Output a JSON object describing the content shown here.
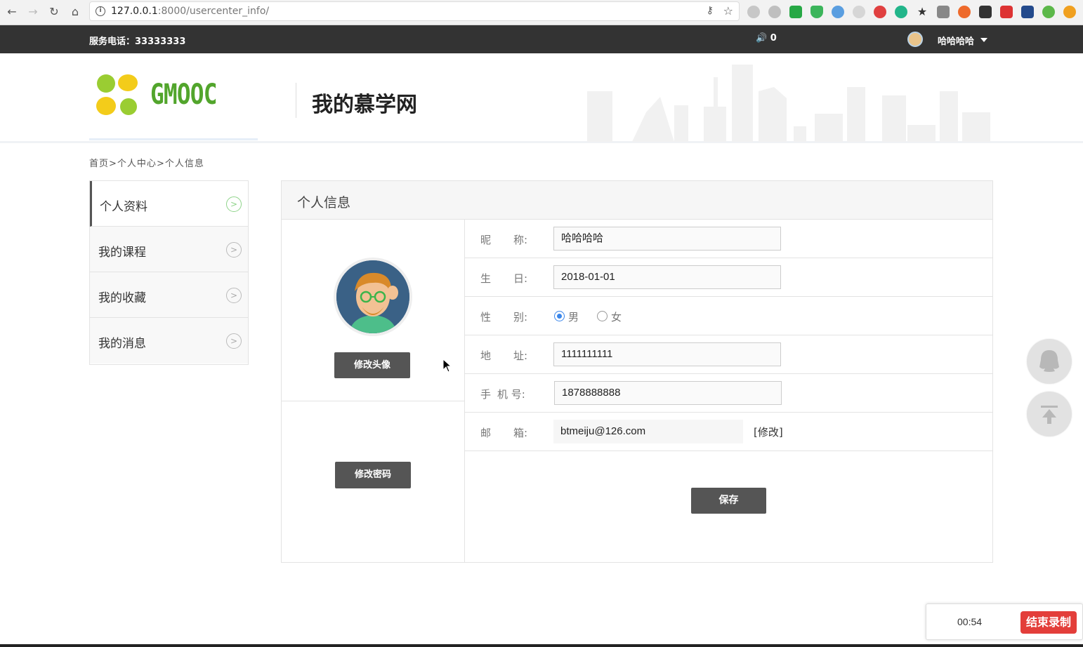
{
  "browser": {
    "url_host": "127.0.0.1",
    "url_rest": ":8000/usercenter_info/"
  },
  "topbar": {
    "phone": "服务电话：33333333",
    "sound_count": "0",
    "username": "哈哈哈哈"
  },
  "header": {
    "logo_text": "GMOOC",
    "title": "我的慕学网",
    "brand_color": "#52a52c"
  },
  "breadcrumb": {
    "home": "首页",
    "sep1": ">",
    "center": "个人中心",
    "sep2": ">",
    "current": "个人信息"
  },
  "sidebar": {
    "items": [
      {
        "label": "个人资料",
        "active": true
      },
      {
        "label": "我的课程",
        "active": false
      },
      {
        "label": "我的收藏",
        "active": false
      },
      {
        "label": "我的消息",
        "active": false
      }
    ]
  },
  "panel": {
    "title": "个人信息",
    "change_avatar_label": "修改头像",
    "change_password_label": "修改密码",
    "save_label": "保存"
  },
  "form": {
    "nickname": {
      "label_a": "昵",
      "label_b": "称:",
      "value": "哈哈哈哈"
    },
    "birthday": {
      "label_a": "生",
      "label_b": "日:",
      "value": "2018-01-01"
    },
    "gender": {
      "label_a": "性",
      "label_b": "别:",
      "male": "男",
      "female": "女",
      "selected": "男"
    },
    "address": {
      "label_a": "地",
      "label_b": "址:",
      "value": "1111111111"
    },
    "mobile": {
      "label_a": "手",
      "label_b": "机   号:",
      "value": "1878888888"
    },
    "email": {
      "label_a": "邮",
      "label_b": "箱:",
      "value": "btmeiju@126.com",
      "edit_label": "[修改]"
    }
  },
  "recorder": {
    "time": "00:54",
    "stop_label": "结束录制",
    "stop_color": "#e33e3a"
  }
}
